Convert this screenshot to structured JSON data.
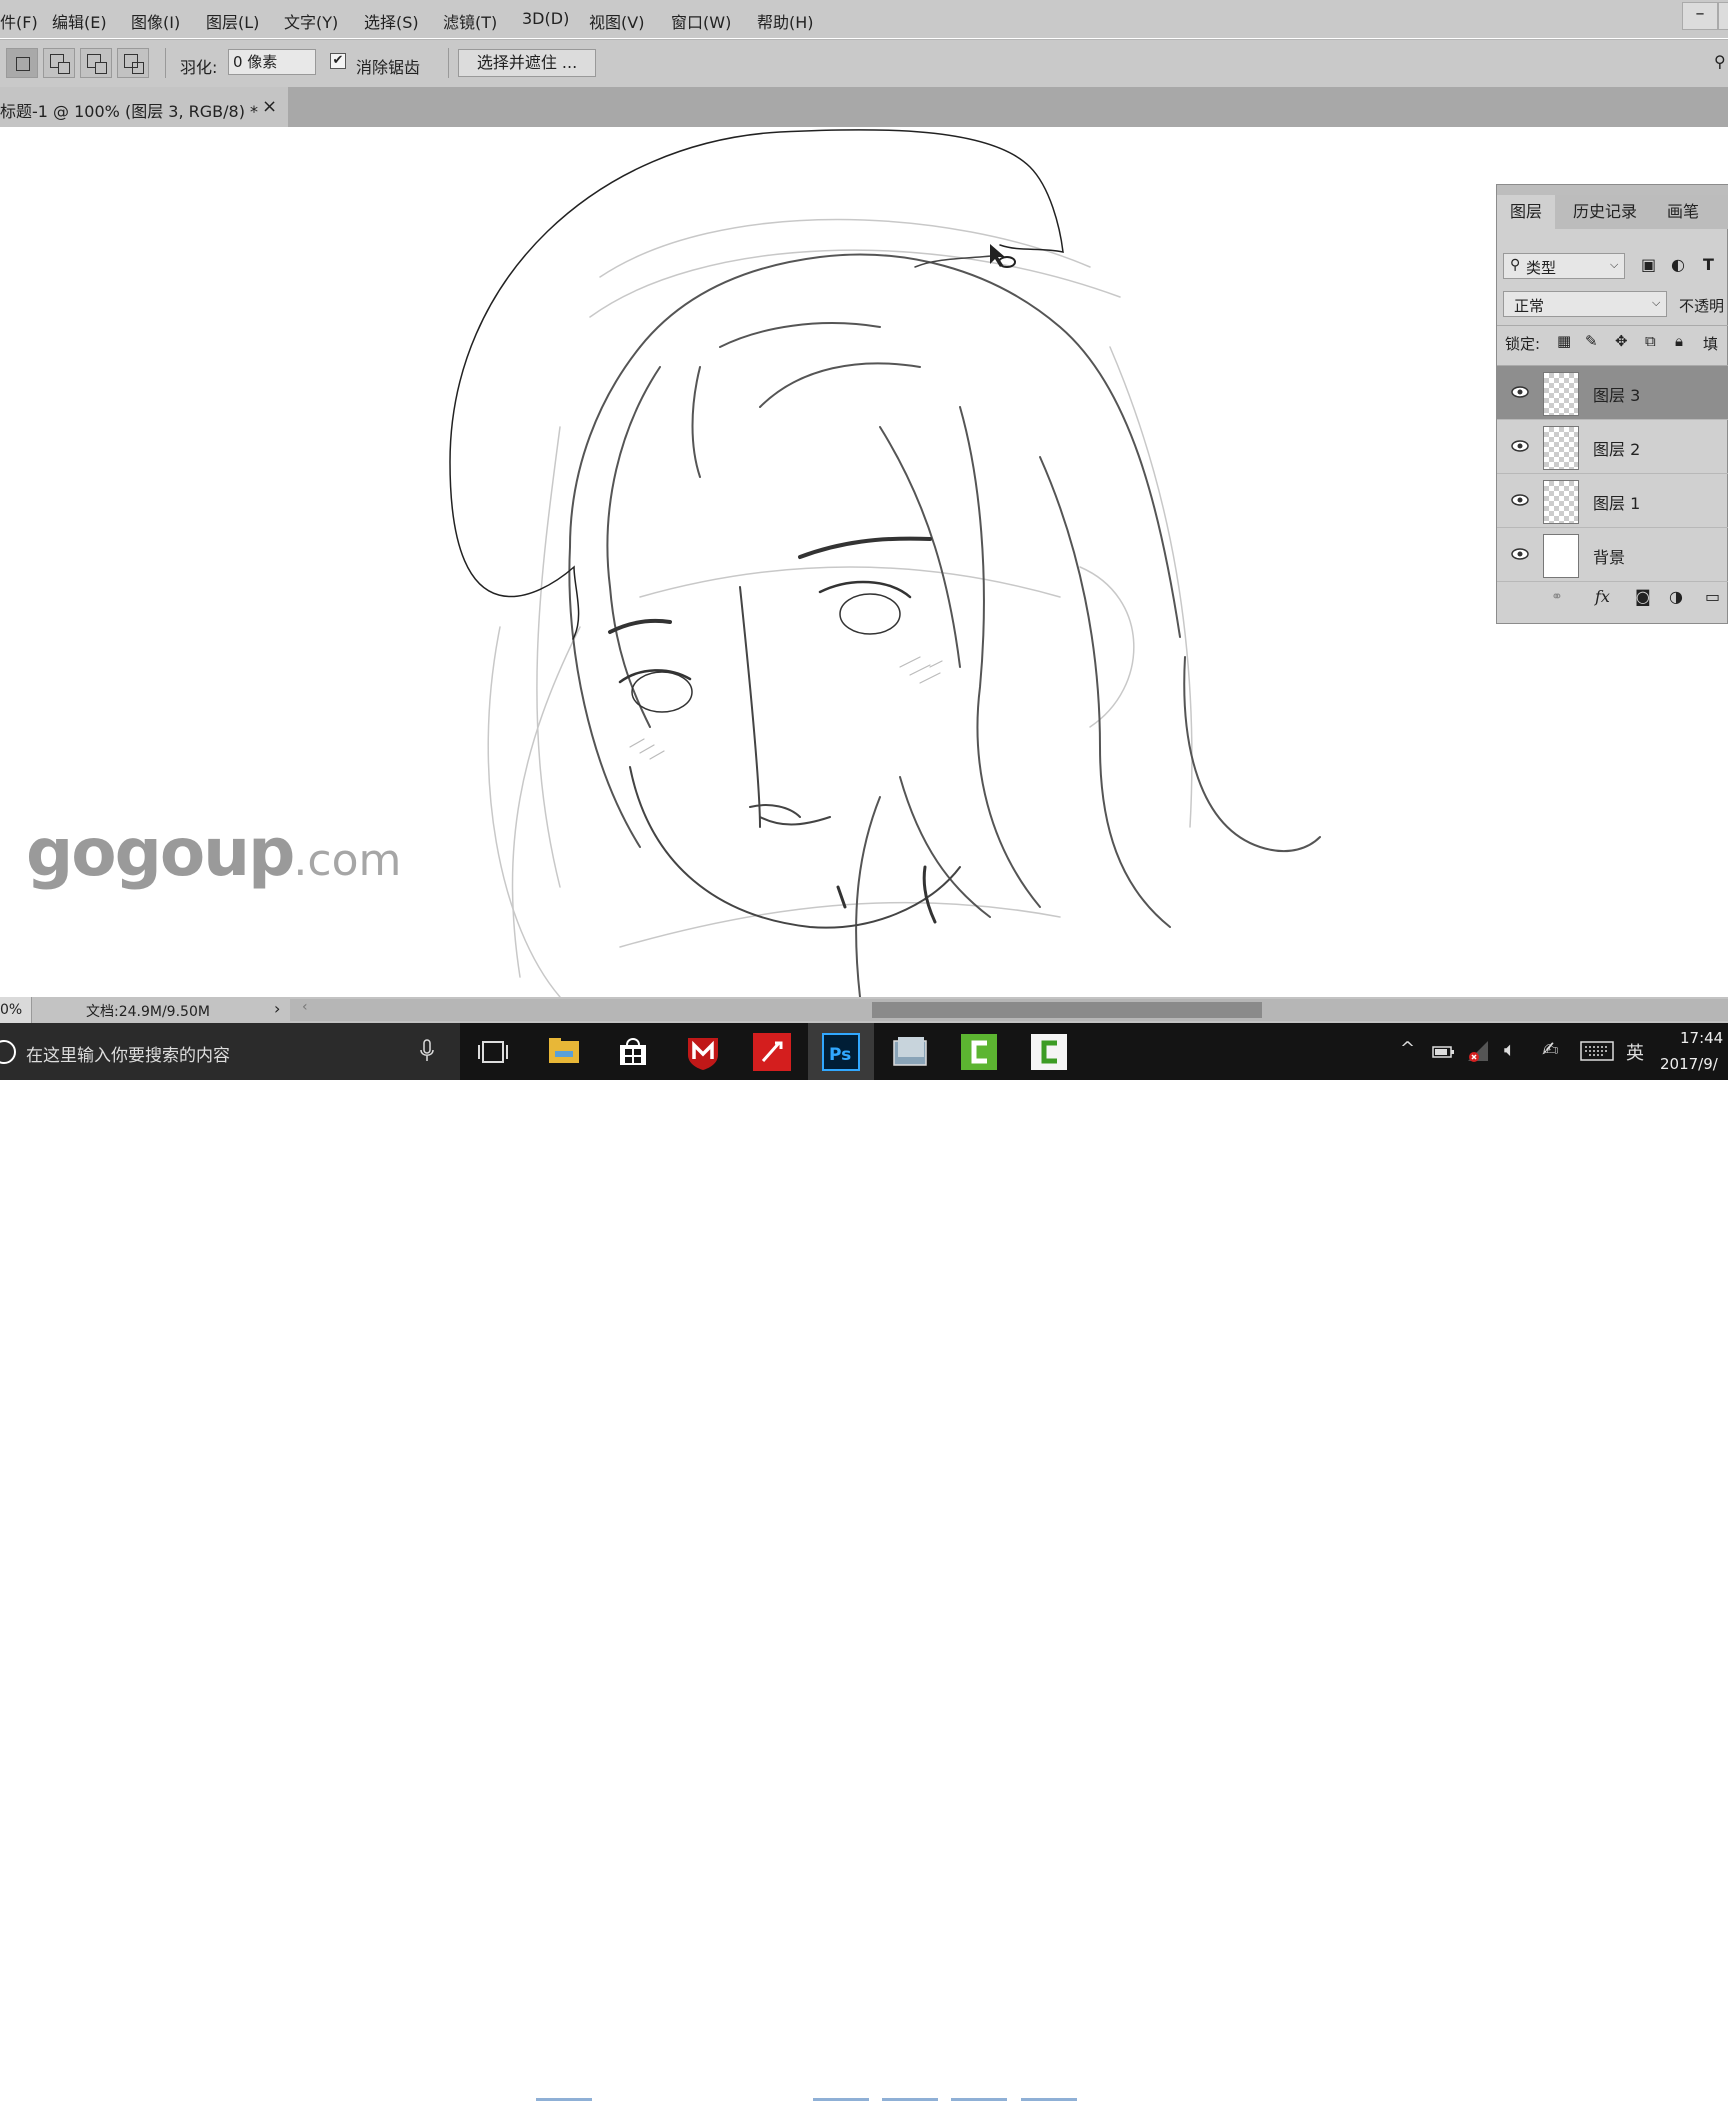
{
  "menubar": {
    "items": [
      "件(F)",
      "编辑(E)",
      "图像(I)",
      "图层(L)",
      "文字(Y)",
      "选择(S)",
      "滤镜(T)",
      "3D(D)",
      "视图(V)",
      "窗口(W)",
      "帮助(H)"
    ],
    "minimize": "–"
  },
  "options": {
    "feather_label": "羽化:",
    "feather_value": "0 像素",
    "antialias_label": "消除锯齿",
    "select_mask_button": "选择并遮住 ..."
  },
  "document": {
    "tab_title": "标题-1 @ 100% (图层 3, RGB/8) *",
    "close": "×"
  },
  "watermark": {
    "main": "gogoup",
    "suffix": ".com"
  },
  "layers_panel": {
    "tabs": [
      "图层",
      "历史记录",
      "画笔"
    ],
    "filter_kind": "类型",
    "blend_mode": "正常",
    "opacity_label": "不透明",
    "lock_label": "锁定:",
    "fill_label": "填",
    "layers": [
      {
        "name": "图层 3",
        "selected": true,
        "transparent": true
      },
      {
        "name": "图层 2",
        "selected": false,
        "transparent": true
      },
      {
        "name": "图层 1",
        "selected": false,
        "transparent": true
      },
      {
        "name": "背景",
        "selected": false,
        "transparent": false
      }
    ],
    "bottom_icons": [
      "link-icon",
      "fx-icon",
      "mask-icon",
      "adjustment-icon",
      "folder-icon"
    ]
  },
  "statusbar": {
    "zoom": "0%",
    "doc_info": "文档:24.9M/9.50M",
    "arrow": "›",
    "scroll_left": "‹"
  },
  "taskbar": {
    "search_placeholder": "在这里输入你要搜索的内容",
    "time": "17:44",
    "date": "2017/9/",
    "ime": "英",
    "apps": [
      "task-view",
      "file-explorer",
      "store",
      "mcafee",
      "pen-app",
      "photoshop",
      "photos",
      "camtasia-green",
      "camtasia-white"
    ]
  },
  "colors": {
    "menubar_bg": "#c9c9c9",
    "panel_bg": "#d0d0d0",
    "selected_layer": "#8e8e8e",
    "taskbar_bg": "#141414",
    "ps_blue": "#31a8ff"
  }
}
